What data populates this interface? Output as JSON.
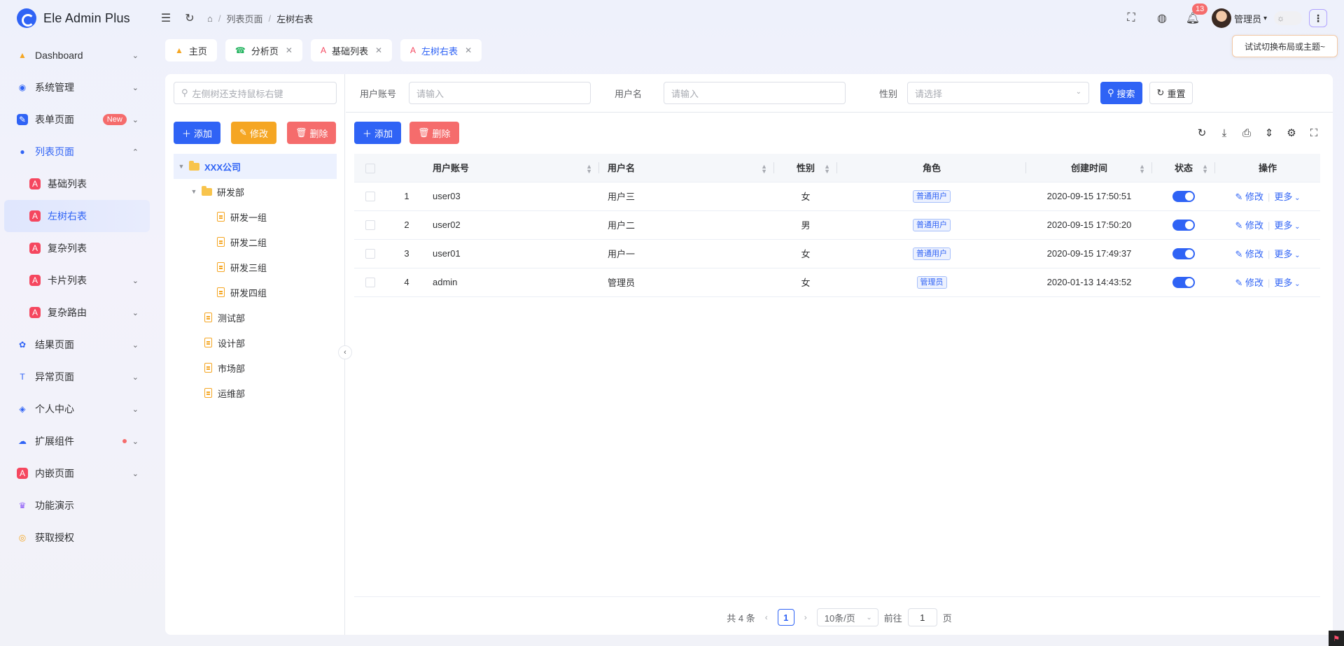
{
  "app": {
    "title": "Ele Admin Plus"
  },
  "breadcrumb": {
    "items": [
      "列表页面",
      "左树右表"
    ]
  },
  "header": {
    "notification_count": "13",
    "user_name": "管理员",
    "theme_icon": "sun-icon"
  },
  "sidebar": {
    "items": [
      {
        "label": "Dashboard",
        "icon": "dashboard-icon",
        "color": "#f5a623"
      },
      {
        "label": "系统管理",
        "icon": "system-icon",
        "color": "#2f63f5"
      },
      {
        "label": "表单页面",
        "icon": "form-icon",
        "color": "#2f63f5",
        "tag": "New"
      },
      {
        "label": "列表页面",
        "icon": "list-icon",
        "color": "#2f63f5"
      },
      {
        "label": "基础列表",
        "icon": "pdf-icon",
        "color": "#f5475f"
      },
      {
        "label": "左树右表",
        "icon": "pdf-icon",
        "color": "#f5475f"
      },
      {
        "label": "复杂列表",
        "icon": "pdf-icon",
        "color": "#f5475f"
      },
      {
        "label": "卡片列表",
        "icon": "pdf-icon",
        "color": "#f5475f"
      },
      {
        "label": "复杂路由",
        "icon": "pdf-icon",
        "color": "#f5475f"
      },
      {
        "label": "结果页面",
        "icon": "result-icon",
        "color": "#2f63f5"
      },
      {
        "label": "异常页面",
        "icon": "exception-icon",
        "color": "#2f63f5"
      },
      {
        "label": "个人中心",
        "icon": "user-center-icon",
        "color": "#2f63f5"
      },
      {
        "label": "扩展组件",
        "icon": "cloud-icon",
        "color": "#2f63f5"
      },
      {
        "label": "内嵌页面",
        "icon": "pdf-icon",
        "color": "#f5475f"
      },
      {
        "label": "功能演示",
        "icon": "crown-icon",
        "color": "#8e5cf7"
      },
      {
        "label": "获取授权",
        "icon": "chrome-icon",
        "color": "#f5a623"
      }
    ]
  },
  "tabs": [
    {
      "label": "主页",
      "closable": false
    },
    {
      "label": "分析页",
      "closable": true
    },
    {
      "label": "基础列表",
      "closable": true
    },
    {
      "label": "左树右表",
      "closable": true,
      "active": true
    }
  ],
  "tooltip": "试试切换布局或主题~",
  "tree": {
    "search_placeholder": "左侧树还支持鼠标右键",
    "add_label": "添加",
    "edit_label": "修改",
    "delete_label": "删除",
    "nodes": {
      "root": "XXX公司",
      "dev": "研发部",
      "dev1": "研发一组",
      "dev2": "研发二组",
      "dev3": "研发三组",
      "dev4": "研发四组",
      "test": "测试部",
      "design": "设计部",
      "market": "市场部",
      "ops": "运维部"
    }
  },
  "filter": {
    "account_label": "用户账号",
    "account_placeholder": "请输入",
    "name_label": "用户名",
    "name_placeholder": "请输入",
    "sex_label": "性别",
    "sex_placeholder": "请选择",
    "search_label": "搜索",
    "reset_label": "重置"
  },
  "table_toolbar": {
    "add_label": "添加",
    "delete_label": "删除"
  },
  "table": {
    "columns": [
      "用户账号",
      "用户名",
      "性别",
      "角色",
      "创建时间",
      "状态",
      "操作"
    ],
    "rows": [
      {
        "index": "1",
        "account": "user03",
        "name": "用户三",
        "sex": "女",
        "role": "普通用户",
        "created": "2020-09-15 17:50:51",
        "enabled": true
      },
      {
        "index": "2",
        "account": "user02",
        "name": "用户二",
        "sex": "男",
        "role": "普通用户",
        "created": "2020-09-15 17:50:20",
        "enabled": true
      },
      {
        "index": "3",
        "account": "user01",
        "name": "用户一",
        "sex": "女",
        "role": "普通用户",
        "created": "2020-09-15 17:49:37",
        "enabled": true
      },
      {
        "index": "4",
        "account": "admin",
        "name": "管理员",
        "sex": "女",
        "role": "管理员",
        "created": "2020-01-13 14:43:52",
        "enabled": true
      }
    ],
    "edit_label": "修改",
    "more_label": "更多"
  },
  "pagination": {
    "total": "共 4 条",
    "current": "1",
    "page_size": "10条/页",
    "goto_label": "前往",
    "goto_value": "1",
    "page_suffix": "页"
  }
}
